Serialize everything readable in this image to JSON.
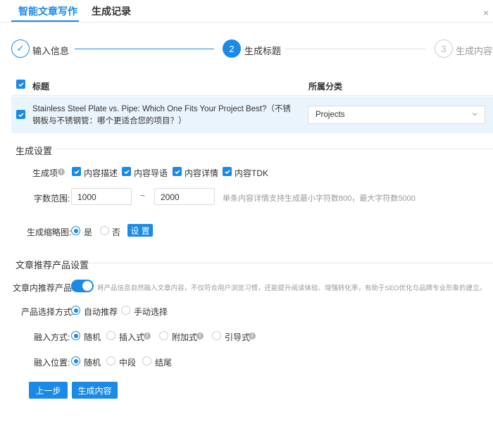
{
  "tabs": {
    "active": "智能文章写作",
    "history": "生成记录",
    "close": "×"
  },
  "steps": [
    {
      "num": "✓",
      "label": "输入信息"
    },
    {
      "num": "2",
      "label": "生成标题"
    },
    {
      "num": "3",
      "label": "生成内容"
    }
  ],
  "table": {
    "col_title": "标题",
    "col_category": "所属分类",
    "rows": [
      {
        "title": "Stainless Steel Plate vs. Pipe: Which One Fits Your Project Best?（不锈钢板与不锈钢管：哪个更适合您的项目？）",
        "category": "Projects"
      }
    ]
  },
  "gen_settings": {
    "section": "生成设置",
    "items_label": "生成项",
    "items": [
      "内容描述",
      "内容导语",
      "内容详情",
      "内容TDK"
    ],
    "word_range_label": "字数范围:",
    "word_min": "1000",
    "word_sep": "~",
    "word_max": "2000",
    "word_hint": "单条内容详情支持生成最小字符数800，最大字符数5000",
    "thumb_label": "生成缩略图:",
    "thumb_yes": "是",
    "thumb_no": "否",
    "thumb_btn": "设 置"
  },
  "rec_settings": {
    "section": "文章推荐产品设置",
    "inline_label": "文章内推荐产品:",
    "inline_hint": "将产品信息自然融入文章内容，不仅符合用户浏览习惯，还能提升阅读体验、增强转化率，有助于SEO优化与品牌专业形象的建立。",
    "select_label": "产品选择方式:",
    "select_auto": "自动推荐",
    "select_manual": "手动选择",
    "mode_label": "融入方式:",
    "modes": [
      "随机",
      "插入式",
      "附加式",
      "引导式"
    ],
    "pos_label": "融入位置:",
    "positions": [
      "随机",
      "中段",
      "结尾"
    ]
  },
  "buttons": {
    "prev": "上一步",
    "generate": "生成内容"
  },
  "colors": {
    "accent": "#1a8ae6",
    "row_highlight": "#eaf4fd"
  }
}
